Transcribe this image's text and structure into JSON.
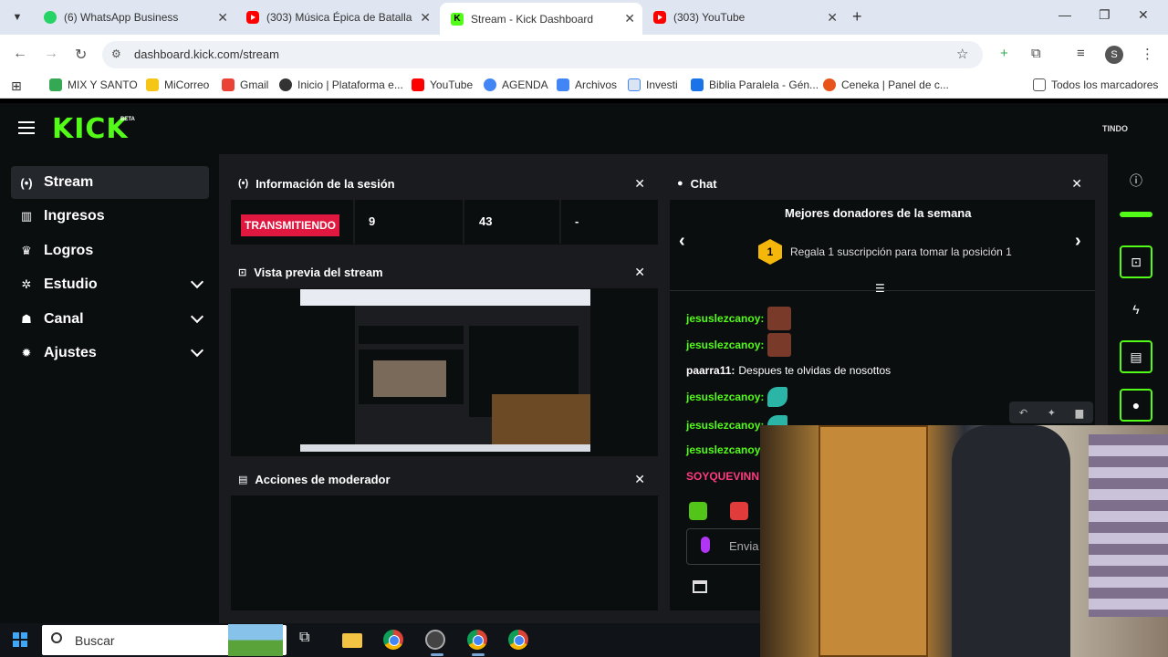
{
  "browser": {
    "tabs": [
      {
        "title": "(6) WhatsApp Business",
        "icon": "whatsapp-icon"
      },
      {
        "title": "(303) Música Épica de Batalla Le",
        "icon": "youtube-icon"
      },
      {
        "title": "Stream - Kick Dashboard",
        "icon": "kick-icon"
      },
      {
        "title": "(303) YouTube",
        "icon": "youtube-icon"
      }
    ],
    "url": "dashboard.kick.com/stream",
    "profile_initial": "S",
    "bookmarks": [
      {
        "label": "MIX Y SANTO",
        "color": "#34a853"
      },
      {
        "label": "MiCorreo",
        "color": "#f5c518"
      },
      {
        "label": "Gmail",
        "color": "#ea4335"
      },
      {
        "label": "Inicio | Plataforma e...",
        "color": "#333333"
      },
      {
        "label": "YouTube",
        "color": "#ff0000"
      },
      {
        "label": "AGENDA",
        "color": "#4285f4"
      },
      {
        "label": "Archivos",
        "color": "#4285f4"
      },
      {
        "label": "Investi",
        "color": "#4285f4"
      },
      {
        "label": "Biblia Paralela - Gén...",
        "color": "#1a73e8"
      },
      {
        "label": "Ceneka | Panel de c...",
        "color": "#e8531a"
      }
    ],
    "all_bookmarks": "Todos los marcadores"
  },
  "kick": {
    "logo": "KICK",
    "beta": "BETA",
    "avatar_text": "TINDO",
    "sidebar": [
      {
        "label": "Stream",
        "icon": "broadcast-icon"
      },
      {
        "label": "Ingresos",
        "icon": "chart-icon"
      },
      {
        "label": "Logros",
        "icon": "trophy-icon"
      },
      {
        "label": "Estudio",
        "icon": "studio-icon"
      },
      {
        "label": "Canal",
        "icon": "users-icon"
      },
      {
        "label": "Ajustes",
        "icon": "gear-icon"
      }
    ],
    "session": {
      "title": "Información de la sesión",
      "status": "TRANSMITIENDO",
      "stats": [
        "9",
        "43",
        "-"
      ]
    },
    "preview": {
      "title": "Vista previa del stream"
    },
    "moderator": {
      "title": "Acciones de moderador"
    },
    "chat": {
      "title": "Chat",
      "top_donors": "Mejores donadores de la semana",
      "rank": "1",
      "rank_text": "Regala 1 suscripción para tomar la posición 1",
      "messages": [
        {
          "user": "jesuslezcanoy:",
          "text": "",
          "emote": "brown"
        },
        {
          "user": "jesuslezcanoy:",
          "text": "",
          "emote": "brown"
        },
        {
          "user": "paarra11:",
          "text": "Despues te olvidas de nosottos",
          "emote": ""
        },
        {
          "user": "jesuslezcanoy:",
          "text": "",
          "emote": "teal"
        },
        {
          "user": "jesuslezcanoy:",
          "text": "",
          "emote": "teal"
        },
        {
          "user": "jesuslezcanoy",
          "text": "",
          "emote": ""
        },
        {
          "user": "SOYQUEVINN",
          "text": "",
          "emote": ""
        }
      ],
      "input_placeholder": "Envia"
    }
  },
  "taskbar": {
    "search_placeholder": "Buscar"
  }
}
